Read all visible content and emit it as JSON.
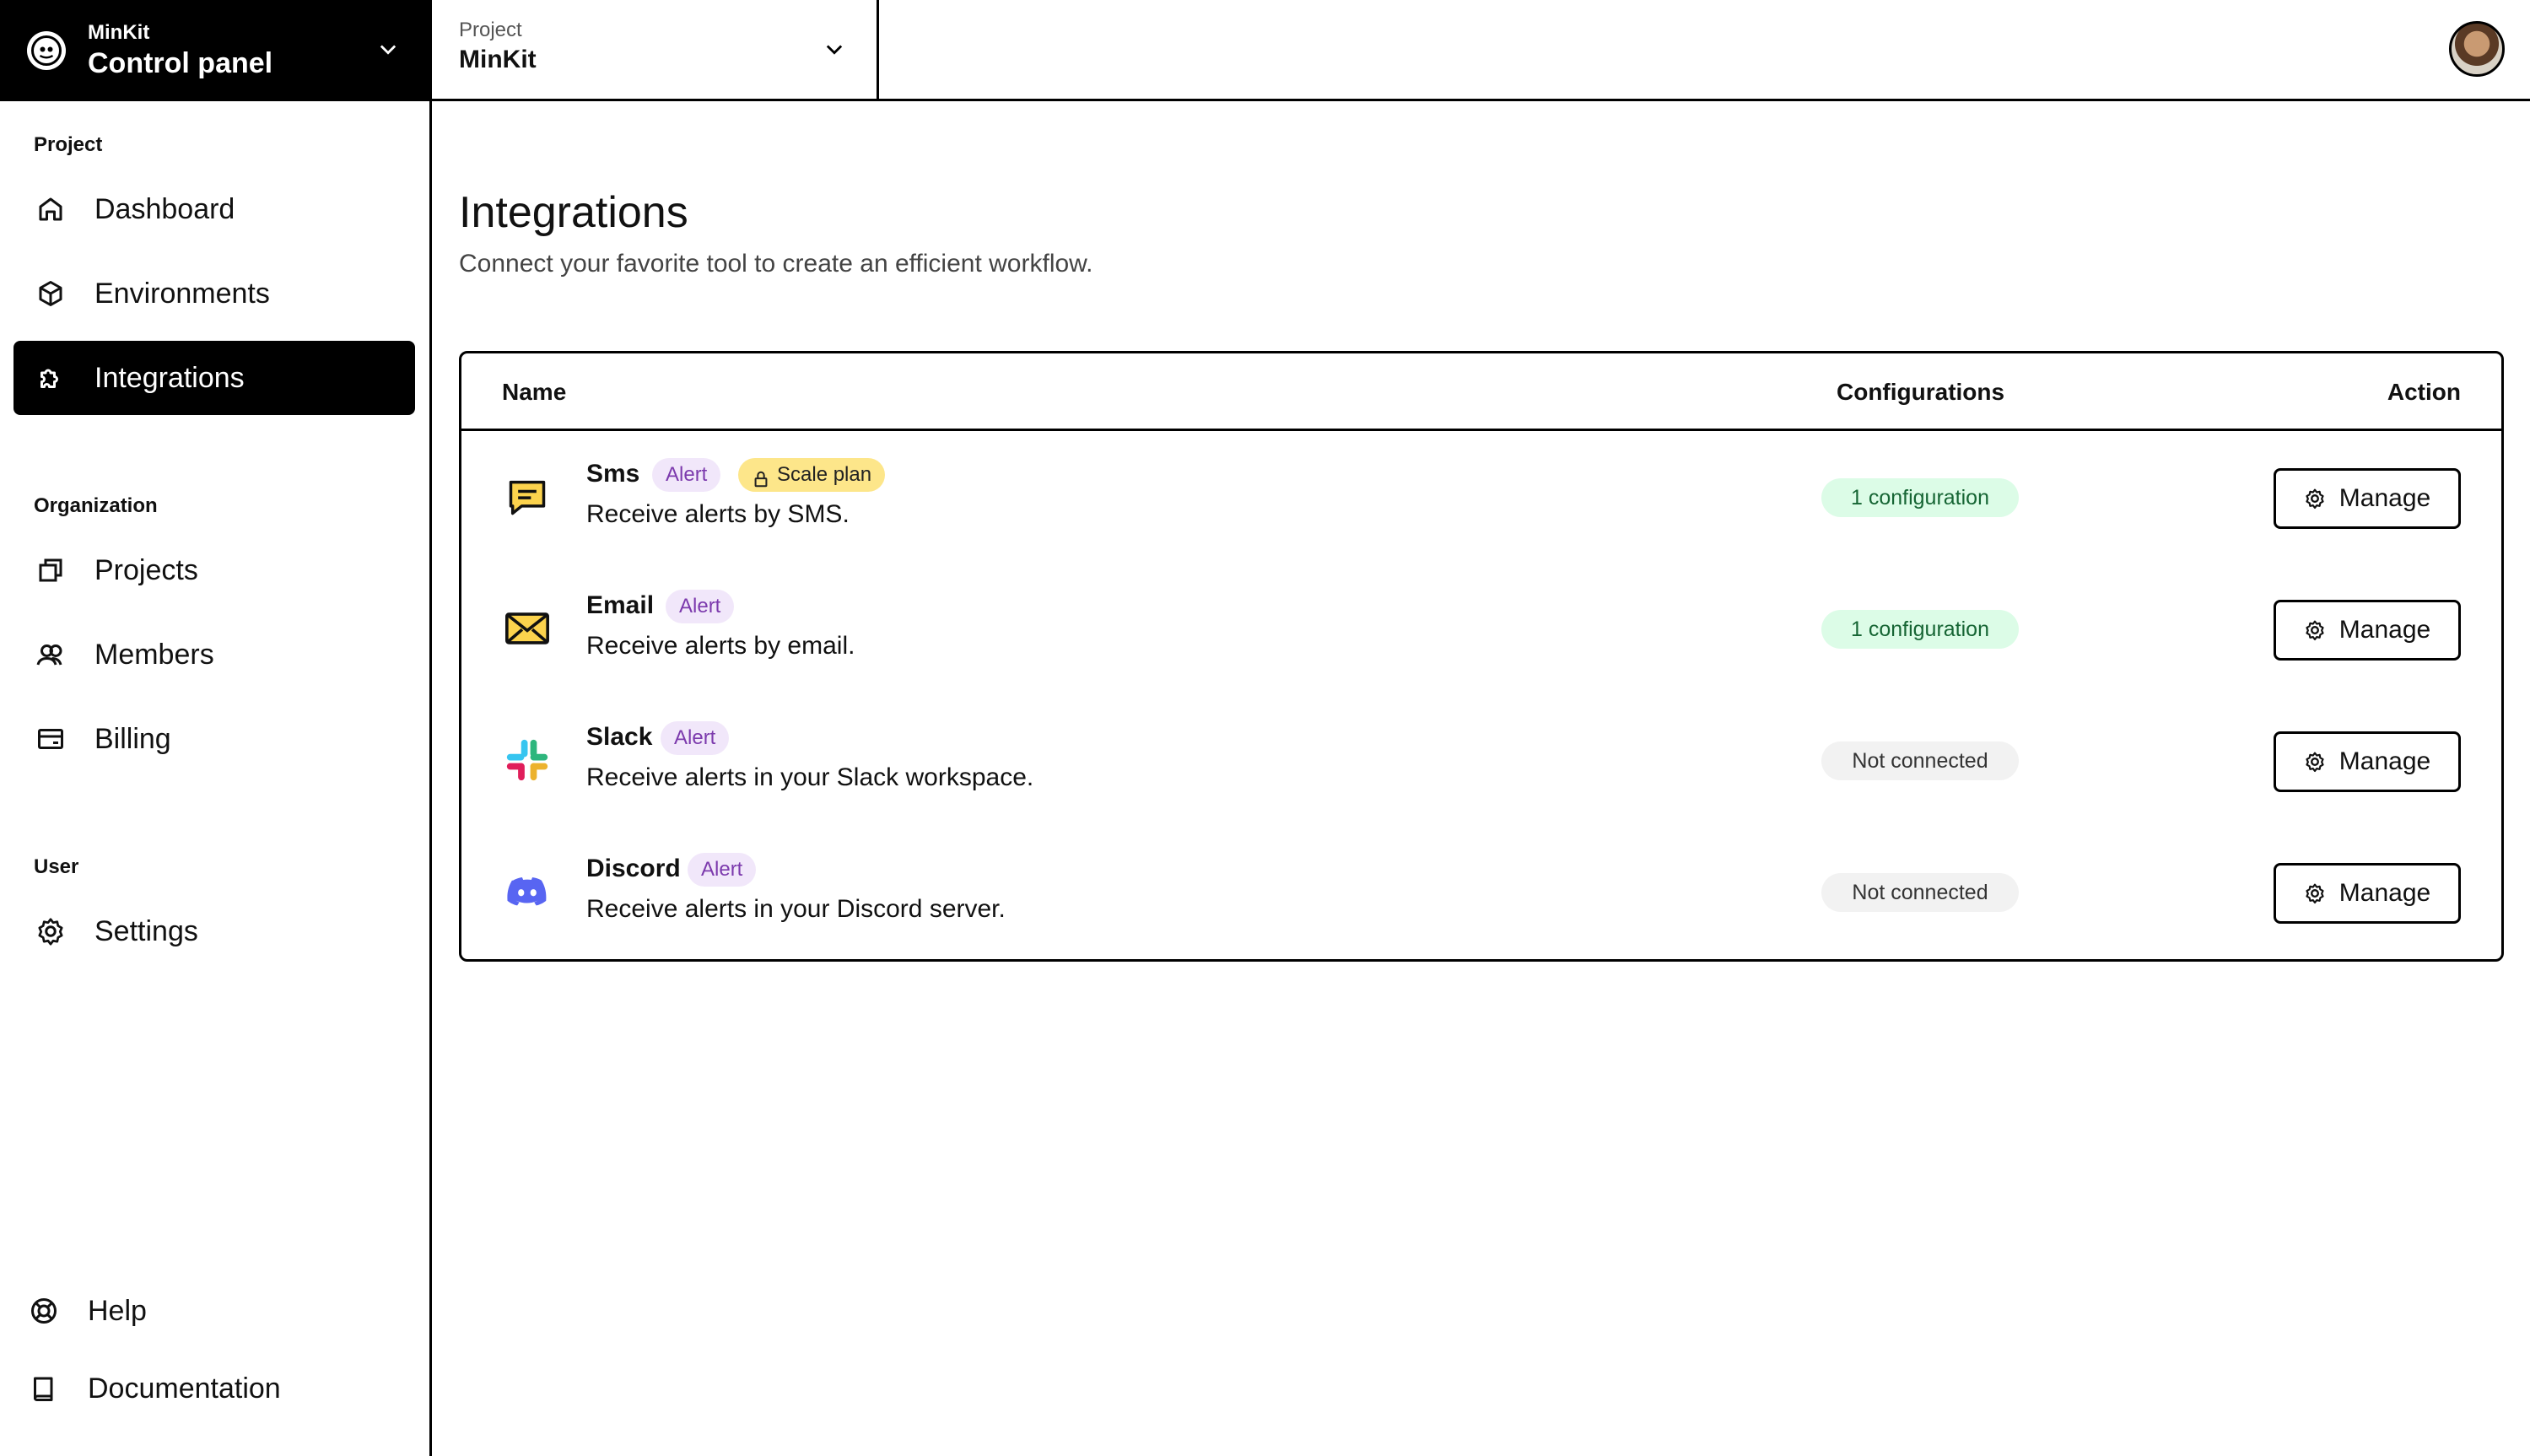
{
  "brand": {
    "org": "MinKit",
    "title": "Control panel"
  },
  "project_selector": {
    "label": "Project",
    "value": "MinKit"
  },
  "sidebar": {
    "sections": [
      {
        "label": "Project",
        "items": [
          {
            "label": "Dashboard",
            "icon": "home-icon"
          },
          {
            "label": "Environments",
            "icon": "cube-icon"
          },
          {
            "label": "Integrations",
            "icon": "puzzle-icon",
            "active": true
          }
        ]
      },
      {
        "label": "Organization",
        "items": [
          {
            "label": "Projects",
            "icon": "stack-icon"
          },
          {
            "label": "Members",
            "icon": "users-icon"
          },
          {
            "label": "Billing",
            "icon": "credit-card-icon"
          }
        ]
      },
      {
        "label": "User",
        "items": [
          {
            "label": "Settings",
            "icon": "gear-icon"
          }
        ]
      }
    ],
    "bottom": [
      {
        "label": "Help",
        "icon": "lifebuoy-icon"
      },
      {
        "label": "Documentation",
        "icon": "book-icon"
      }
    ]
  },
  "main": {
    "title": "Integrations",
    "subtitle": "Connect your favorite tool to create an efficient workflow.",
    "table": {
      "headers": {
        "name": "Name",
        "configurations": "Configurations",
        "action": "Action"
      },
      "rows": [
        {
          "name": "Sms",
          "tag": "Alert",
          "plan": "Scale plan",
          "description": "Receive alerts by SMS.",
          "status": "1 configuration",
          "action": "Manage",
          "icon": "sms-icon"
        },
        {
          "name": "Email",
          "tag": "Alert",
          "description": "Receive alerts by email.",
          "status": "1 configuration",
          "action": "Manage",
          "icon": "email-icon"
        },
        {
          "name": "Slack",
          "tag": "Alert",
          "description": "Receive alerts in your Slack workspace.",
          "status": "Not connected",
          "action": "Manage",
          "icon": "slack-icon"
        },
        {
          "name": "Discord",
          "tag": "Alert",
          "description": "Receive alerts in your Discord server.",
          "status": "Not connected",
          "action": "Manage",
          "icon": "discord-icon"
        }
      ]
    }
  },
  "colors": {
    "alert_tag_bg": "#f1e7fa",
    "alert_tag_fg": "#7c3aad",
    "plan_tag_bg": "#fde68a",
    "ok_status_bg": "#dcfce7",
    "ok_status_fg": "#166534",
    "off_status_bg": "#f2f2f2",
    "icon_yellow": "#fcd34d",
    "discord": "#5865f2"
  }
}
